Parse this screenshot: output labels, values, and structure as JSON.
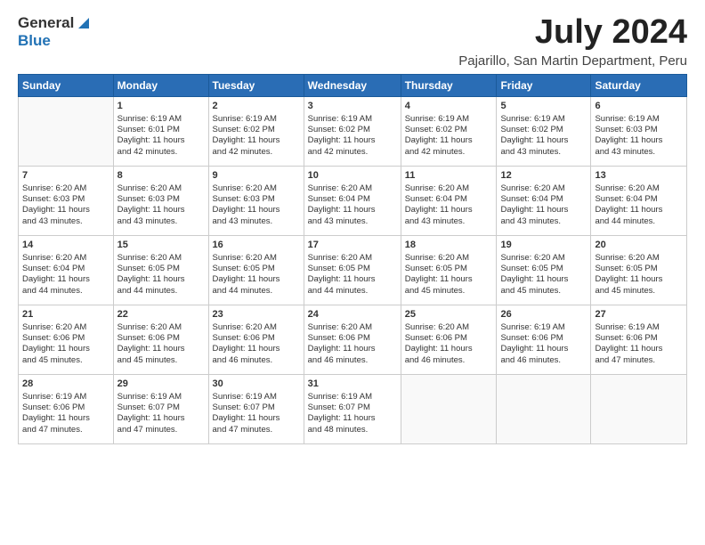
{
  "header": {
    "logo_general": "General",
    "logo_blue": "Blue",
    "month_title": "July 2024",
    "location": "Pajarillo, San Martin Department, Peru"
  },
  "weekdays": [
    "Sunday",
    "Monday",
    "Tuesday",
    "Wednesday",
    "Thursday",
    "Friday",
    "Saturday"
  ],
  "weeks": [
    [
      {
        "day": "",
        "info": ""
      },
      {
        "day": "1",
        "info": "Sunrise: 6:19 AM\nSunset: 6:01 PM\nDaylight: 11 hours\nand 42 minutes."
      },
      {
        "day": "2",
        "info": "Sunrise: 6:19 AM\nSunset: 6:02 PM\nDaylight: 11 hours\nand 42 minutes."
      },
      {
        "day": "3",
        "info": "Sunrise: 6:19 AM\nSunset: 6:02 PM\nDaylight: 11 hours\nand 42 minutes."
      },
      {
        "day": "4",
        "info": "Sunrise: 6:19 AM\nSunset: 6:02 PM\nDaylight: 11 hours\nand 42 minutes."
      },
      {
        "day": "5",
        "info": "Sunrise: 6:19 AM\nSunset: 6:02 PM\nDaylight: 11 hours\nand 43 minutes."
      },
      {
        "day": "6",
        "info": "Sunrise: 6:19 AM\nSunset: 6:03 PM\nDaylight: 11 hours\nand 43 minutes."
      }
    ],
    [
      {
        "day": "7",
        "info": "Sunrise: 6:20 AM\nSunset: 6:03 PM\nDaylight: 11 hours\nand 43 minutes."
      },
      {
        "day": "8",
        "info": "Sunrise: 6:20 AM\nSunset: 6:03 PM\nDaylight: 11 hours\nand 43 minutes."
      },
      {
        "day": "9",
        "info": "Sunrise: 6:20 AM\nSunset: 6:03 PM\nDaylight: 11 hours\nand 43 minutes."
      },
      {
        "day": "10",
        "info": "Sunrise: 6:20 AM\nSunset: 6:04 PM\nDaylight: 11 hours\nand 43 minutes."
      },
      {
        "day": "11",
        "info": "Sunrise: 6:20 AM\nSunset: 6:04 PM\nDaylight: 11 hours\nand 43 minutes."
      },
      {
        "day": "12",
        "info": "Sunrise: 6:20 AM\nSunset: 6:04 PM\nDaylight: 11 hours\nand 43 minutes."
      },
      {
        "day": "13",
        "info": "Sunrise: 6:20 AM\nSunset: 6:04 PM\nDaylight: 11 hours\nand 44 minutes."
      }
    ],
    [
      {
        "day": "14",
        "info": "Sunrise: 6:20 AM\nSunset: 6:04 PM\nDaylight: 11 hours\nand 44 minutes."
      },
      {
        "day": "15",
        "info": "Sunrise: 6:20 AM\nSunset: 6:05 PM\nDaylight: 11 hours\nand 44 minutes."
      },
      {
        "day": "16",
        "info": "Sunrise: 6:20 AM\nSunset: 6:05 PM\nDaylight: 11 hours\nand 44 minutes."
      },
      {
        "day": "17",
        "info": "Sunrise: 6:20 AM\nSunset: 6:05 PM\nDaylight: 11 hours\nand 44 minutes."
      },
      {
        "day": "18",
        "info": "Sunrise: 6:20 AM\nSunset: 6:05 PM\nDaylight: 11 hours\nand 45 minutes."
      },
      {
        "day": "19",
        "info": "Sunrise: 6:20 AM\nSunset: 6:05 PM\nDaylight: 11 hours\nand 45 minutes."
      },
      {
        "day": "20",
        "info": "Sunrise: 6:20 AM\nSunset: 6:05 PM\nDaylight: 11 hours\nand 45 minutes."
      }
    ],
    [
      {
        "day": "21",
        "info": "Sunrise: 6:20 AM\nSunset: 6:06 PM\nDaylight: 11 hours\nand 45 minutes."
      },
      {
        "day": "22",
        "info": "Sunrise: 6:20 AM\nSunset: 6:06 PM\nDaylight: 11 hours\nand 45 minutes."
      },
      {
        "day": "23",
        "info": "Sunrise: 6:20 AM\nSunset: 6:06 PM\nDaylight: 11 hours\nand 46 minutes."
      },
      {
        "day": "24",
        "info": "Sunrise: 6:20 AM\nSunset: 6:06 PM\nDaylight: 11 hours\nand 46 minutes."
      },
      {
        "day": "25",
        "info": "Sunrise: 6:20 AM\nSunset: 6:06 PM\nDaylight: 11 hours\nand 46 minutes."
      },
      {
        "day": "26",
        "info": "Sunrise: 6:19 AM\nSunset: 6:06 PM\nDaylight: 11 hours\nand 46 minutes."
      },
      {
        "day": "27",
        "info": "Sunrise: 6:19 AM\nSunset: 6:06 PM\nDaylight: 11 hours\nand 47 minutes."
      }
    ],
    [
      {
        "day": "28",
        "info": "Sunrise: 6:19 AM\nSunset: 6:06 PM\nDaylight: 11 hours\nand 47 minutes."
      },
      {
        "day": "29",
        "info": "Sunrise: 6:19 AM\nSunset: 6:07 PM\nDaylight: 11 hours\nand 47 minutes."
      },
      {
        "day": "30",
        "info": "Sunrise: 6:19 AM\nSunset: 6:07 PM\nDaylight: 11 hours\nand 47 minutes."
      },
      {
        "day": "31",
        "info": "Sunrise: 6:19 AM\nSunset: 6:07 PM\nDaylight: 11 hours\nand 48 minutes."
      },
      {
        "day": "",
        "info": ""
      },
      {
        "day": "",
        "info": ""
      },
      {
        "day": "",
        "info": ""
      }
    ]
  ]
}
